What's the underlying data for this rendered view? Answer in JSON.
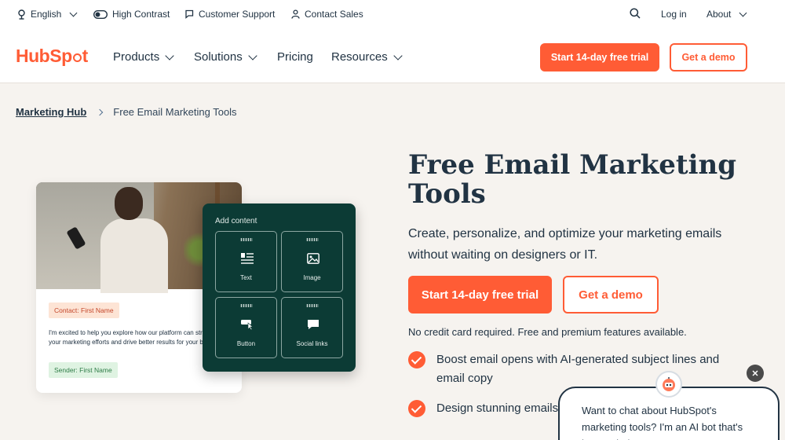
{
  "utility": {
    "language": "English",
    "high_contrast": "High Contrast",
    "support": "Customer Support",
    "contact_sales": "Contact Sales",
    "login": "Log in",
    "about": "About"
  },
  "nav": {
    "logo": {
      "part1": "Hub",
      "part2": "p",
      "part3": "t"
    },
    "items": [
      "Products",
      "Solutions",
      "Pricing",
      "Resources"
    ],
    "cta_primary": "Start 14-day free trial",
    "cta_secondary": "Get a demo"
  },
  "breadcrumb": {
    "parent": "Marketing Hub",
    "current": "Free Email Marketing Tools"
  },
  "illustration": {
    "contact_chip": "Contact: First Name",
    "email_body": "I'm excited to help you explore how our platform can streamline your marketing efforts and drive better results for your business.",
    "sender_chip": "Sender: First Name",
    "panel_title": "Add content",
    "tiles": [
      "Text",
      "Image",
      "Button",
      "Social links"
    ]
  },
  "hero": {
    "title": "Free Email Marketing Tools",
    "subtitle": "Create, personalize, and optimize your marketing emails without waiting on designers or IT.",
    "cta_primary": "Start 14-day free trial",
    "cta_secondary": "Get a demo",
    "note": "No credit card required. Free and premium features available.",
    "features": [
      "Boost email opens with AI-generated subject lines and email copy",
      "Design stunning emails with newsletters, events, and"
    ]
  },
  "chat": {
    "message": "Want to chat about HubSpot's marketing tools? I'm an AI bot that's here to help!"
  },
  "colors": {
    "brand_orange": "#ff5c35",
    "navy": "#213343",
    "panel_green": "#0c3b35",
    "page_bg": "#f6f3ef"
  }
}
